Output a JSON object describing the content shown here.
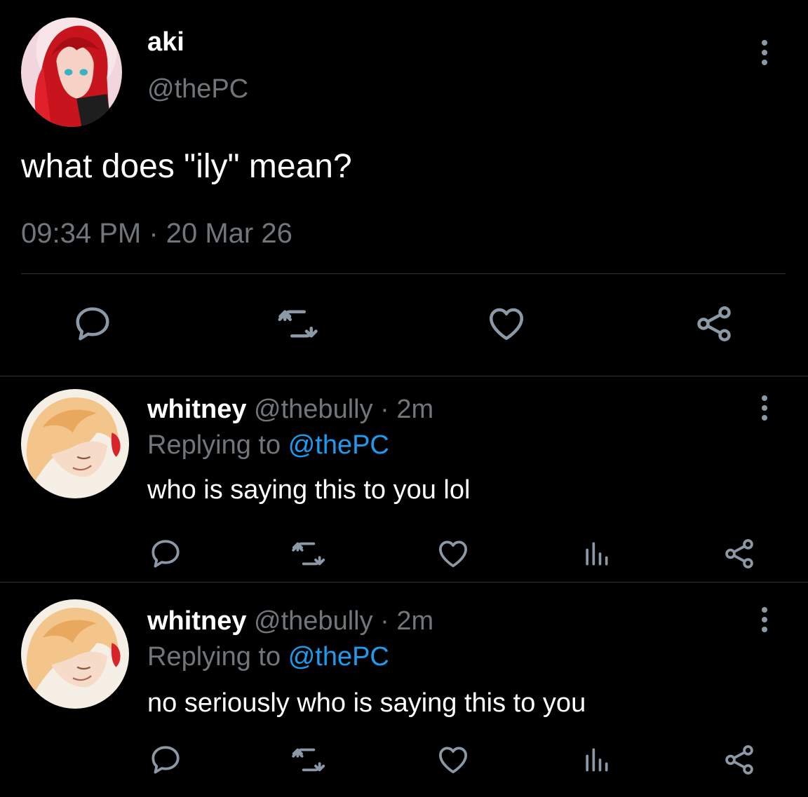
{
  "main_tweet": {
    "author_name": "aki",
    "author_handle": "@thePC",
    "text": "what does \"ily\" mean?",
    "timestamp": "09:34 PM · 20 Mar 26",
    "avatar_icon": "red-hair-anime-avatar"
  },
  "replies": [
    {
      "author_name": "whitney",
      "author_handle": "@thebully",
      "separator": "·",
      "age": "2m",
      "replying_prefix": "Replying to",
      "replying_mention": "@thePC",
      "text": "who is saying this to you lol",
      "avatar_icon": "blonde-hair-anime-avatar"
    },
    {
      "author_name": "whitney",
      "author_handle": "@thebully",
      "separator": "·",
      "age": "2m",
      "replying_prefix": "Replying to",
      "replying_mention": "@thePC",
      "text": "no seriously who is saying this to you",
      "avatar_icon": "blonde-hair-anime-avatar"
    }
  ],
  "colors": {
    "background": "#000000",
    "primary_text": "#ffffff",
    "secondary_text": "#71767b",
    "mention": "#1d9bf0",
    "divider": "#2f3336",
    "icon": "#8b98a5"
  }
}
